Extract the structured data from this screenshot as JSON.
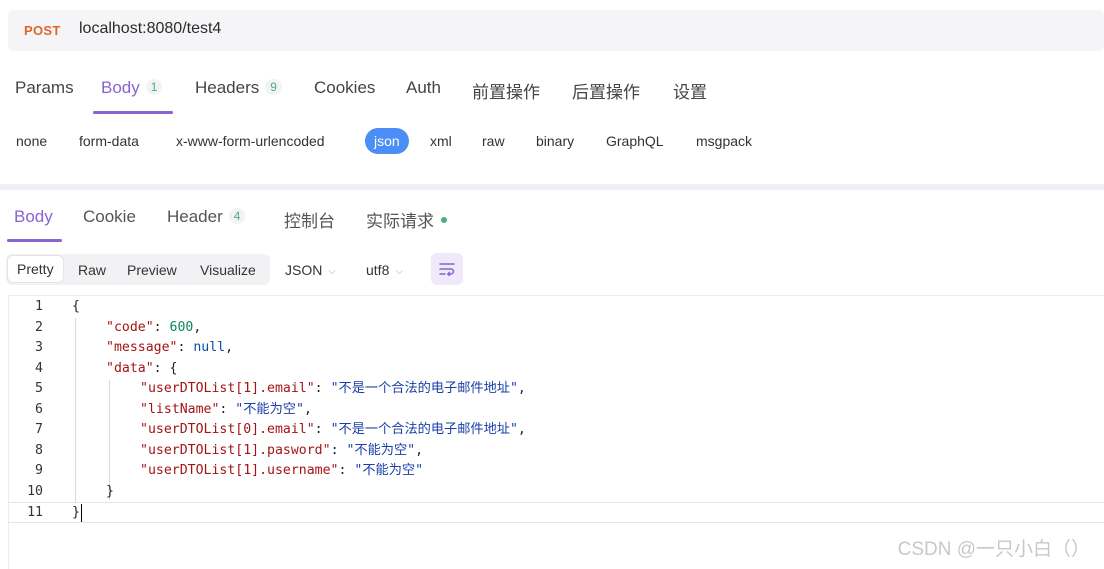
{
  "request": {
    "method": "POST",
    "url": "localhost:8080/test4"
  },
  "request_tabs": [
    {
      "label": "Params",
      "count": ""
    },
    {
      "label": "Body",
      "count": "1"
    },
    {
      "label": "Headers",
      "count": "9"
    },
    {
      "label": "Cookies",
      "count": ""
    },
    {
      "label": "Auth",
      "count": ""
    },
    {
      "label": "前置操作",
      "count": ""
    },
    {
      "label": "后置操作",
      "count": ""
    },
    {
      "label": "设置",
      "count": ""
    }
  ],
  "body_types": [
    "none",
    "form-data",
    "x-www-form-urlencoded",
    "json",
    "xml",
    "raw",
    "binary",
    "GraphQL",
    "msgpack"
  ],
  "response_tabs": [
    {
      "label": "Body",
      "count": ""
    },
    {
      "label": "Cookie",
      "count": ""
    },
    {
      "label": "Header",
      "count": "4"
    },
    {
      "label": "控制台",
      "count": ""
    },
    {
      "label": "实际请求",
      "count": ""
    }
  ],
  "view_modes": [
    "Pretty",
    "Raw",
    "Preview",
    "Visualize"
  ],
  "format_select": "JSON",
  "encoding_select": "utf8",
  "colors": {
    "accent": "#8a63d2",
    "active_chip": "#4b8ef5",
    "method": "#e0662a",
    "status_dot": "#4caf7d"
  },
  "editor": {
    "line_numbers": [
      "1",
      "2",
      "3",
      "4",
      "5",
      "6",
      "7",
      "8",
      "9",
      "10",
      "11"
    ],
    "lines": [
      {
        "parts": [
          {
            "t": "p",
            "v": "{"
          }
        ]
      },
      {
        "parts": [
          {
            "t": "k",
            "v": "\"code\""
          },
          {
            "t": "p",
            "v": ": "
          },
          {
            "t": "n",
            "v": "600"
          },
          {
            "t": "p",
            "v": ","
          }
        ]
      },
      {
        "parts": [
          {
            "t": "k",
            "v": "\"message\""
          },
          {
            "t": "p",
            "v": ": "
          },
          {
            "t": "nul",
            "v": "null"
          },
          {
            "t": "p",
            "v": ","
          }
        ]
      },
      {
        "parts": [
          {
            "t": "k",
            "v": "\"data\""
          },
          {
            "t": "p",
            "v": ": {"
          }
        ]
      },
      {
        "parts": [
          {
            "t": "k",
            "v": "\"userDTOList[1].email\""
          },
          {
            "t": "p",
            "v": ": "
          },
          {
            "t": "s",
            "v": "\"不是一个合法的电子邮件地址\""
          },
          {
            "t": "p",
            "v": ","
          }
        ]
      },
      {
        "parts": [
          {
            "t": "k",
            "v": "\"listName\""
          },
          {
            "t": "p",
            "v": ": "
          },
          {
            "t": "s",
            "v": "\"不能为空\""
          },
          {
            "t": "p",
            "v": ","
          }
        ]
      },
      {
        "parts": [
          {
            "t": "k",
            "v": "\"userDTOList[0].email\""
          },
          {
            "t": "p",
            "v": ": "
          },
          {
            "t": "s",
            "v": "\"不是一个合法的电子邮件地址\""
          },
          {
            "t": "p",
            "v": ","
          }
        ]
      },
      {
        "parts": [
          {
            "t": "k",
            "v": "\"userDTOList[1].pasword\""
          },
          {
            "t": "p",
            "v": ": "
          },
          {
            "t": "s",
            "v": "\"不能为空\""
          },
          {
            "t": "p",
            "v": ","
          }
        ]
      },
      {
        "parts": [
          {
            "t": "k",
            "v": "\"userDTOList[1].username\""
          },
          {
            "t": "p",
            "v": ": "
          },
          {
            "t": "s",
            "v": "\"不能为空\""
          }
        ]
      },
      {
        "parts": [
          {
            "t": "p",
            "v": "}"
          }
        ]
      },
      {
        "parts": [
          {
            "t": "p",
            "v": "}"
          }
        ]
      }
    ]
  },
  "watermark": "CSDN @一只小白（）"
}
